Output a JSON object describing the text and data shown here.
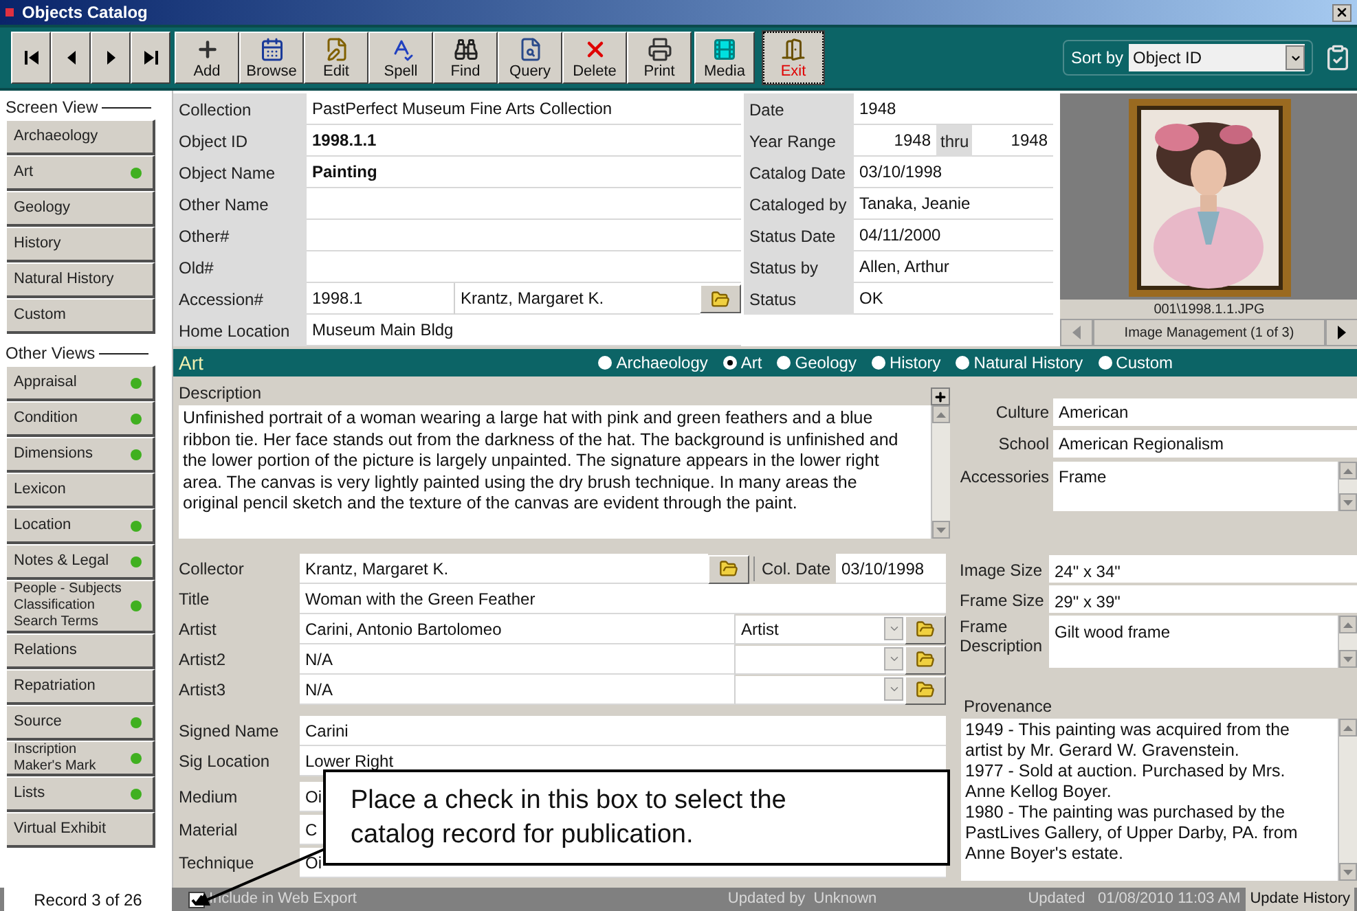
{
  "window": {
    "title": "Objects Catalog"
  },
  "toolbar": [
    {
      "kind": "add",
      "label": "Add"
    },
    {
      "kind": "browse",
      "label": "Browse"
    },
    {
      "kind": "edit",
      "label": "Edit"
    },
    {
      "kind": "spell",
      "label": "Spell"
    },
    {
      "kind": "find",
      "label": "Find"
    },
    {
      "kind": "query",
      "label": "Query"
    },
    {
      "kind": "delete",
      "label": "Delete"
    },
    {
      "kind": "print",
      "label": "Print"
    },
    {
      "kind": "media",
      "label": "Media"
    },
    {
      "kind": "exit",
      "label": "Exit"
    }
  ],
  "sort": {
    "label": "Sort by",
    "value": "Object ID"
  },
  "sidebar": {
    "screen_view": {
      "title": "Screen View",
      "items": [
        {
          "label": "Archaeology",
          "has_data": false
        },
        {
          "label": "Art",
          "has_data": true
        },
        {
          "label": "Geology",
          "has_data": false
        },
        {
          "label": "History",
          "has_data": false
        },
        {
          "label": "Natural History",
          "has_data": false
        },
        {
          "label": "Custom",
          "has_data": false
        }
      ]
    },
    "other_views": {
      "title": "Other Views",
      "items": [
        {
          "label": "Appraisal",
          "has_data": true
        },
        {
          "label": "Condition",
          "has_data": true
        },
        {
          "label": "Dimensions",
          "has_data": true
        },
        {
          "label": "Lexicon",
          "has_data": false
        },
        {
          "label": "Location",
          "has_data": true
        },
        {
          "label": "Notes & Legal",
          "has_data": true
        },
        {
          "label": "People - Subjects\nClassification\nSearch Terms",
          "has_data": true
        },
        {
          "label": "Relations",
          "has_data": false
        },
        {
          "label": "Repatriation",
          "has_data": false
        },
        {
          "label": "Source",
          "has_data": true
        },
        {
          "label": "Inscription\nMaker's Mark",
          "has_data": true
        },
        {
          "label": "Lists",
          "has_data": true
        },
        {
          "label": "Virtual Exhibit",
          "has_data": false
        }
      ]
    }
  },
  "main_fields": [
    {
      "kind": "text",
      "label": "Collection",
      "value": "PastPerfect Museum Fine Arts Collection",
      "bold": false
    },
    {
      "kind": "text",
      "label": "Object ID",
      "value": "1998.1.1",
      "bold": true
    },
    {
      "kind": "text",
      "label": "Object Name",
      "value": "Painting",
      "bold": true
    },
    {
      "kind": "text",
      "label": "Other Name"
    },
    {
      "kind": "text",
      "label": "Other#"
    },
    {
      "kind": "text",
      "label": "Old#"
    },
    {
      "kind": "lookup",
      "label": "Accession#",
      "value": "1998.1",
      "value_2": "Krantz, Margaret K.",
      "bold": false
    },
    {
      "kind": "text",
      "label": "Home Location",
      "value": "Museum Main Bldg",
      "bold": false
    }
  ],
  "status_fields": [
    {
      "kind": "text",
      "label": "Date",
      "value": "1948"
    },
    {
      "kind": "range",
      "label": "Year Range",
      "value": "1948",
      "middle": "thru",
      "value_2": "1948"
    },
    {
      "kind": "text",
      "label": "Catalog Date",
      "value": "03/10/1998"
    },
    {
      "kind": "text",
      "label": "Cataloged by",
      "value": "Tanaka, Jeanie"
    },
    {
      "kind": "text",
      "label": "Status Date",
      "value": "04/11/2000"
    },
    {
      "kind": "text",
      "label": "Status by",
      "value": "Allen, Arthur"
    },
    {
      "kind": "text",
      "label": "Status",
      "value": "OK"
    }
  ],
  "image_panel": {
    "kind": "picture",
    "caption": "001\\1998.1.1.JPG",
    "nav_label": "Image Management (1 of 3)"
  },
  "section": {
    "title": "Art",
    "views": [
      {
        "label": "Archaeology",
        "selected": false
      },
      {
        "label": "Art",
        "selected": true
      },
      {
        "label": "Geology",
        "selected": false
      },
      {
        "label": "History",
        "selected": false
      },
      {
        "label": "Natural History",
        "selected": false
      },
      {
        "label": "Custom",
        "selected": false
      }
    ]
  },
  "description": {
    "label": "Description",
    "text": "Unfinished portrait of a woman wearing a large hat with pink and green feathers and a blue ribbon tie. Her face stands out from the darkness of the hat. The background is unfinished and the lower portion of the picture is largely unpainted. The signature appears in the lower right area. The canvas is very lightly painted using the dry brush technique. In many areas the original pencil sketch and the texture of the canvas are evident through the paint."
  },
  "art_fields": [
    {
      "kind": "text",
      "label": "Culture",
      "value": "American"
    },
    {
      "kind": "text",
      "label": "School",
      "value": "American Regionalism"
    },
    {
      "kind": "memo",
      "label": "Accessories",
      "value": "Frame"
    }
  ],
  "lower_fields": [
    [
      {
        "kind": "collector",
        "label": "Collector",
        "value": "Krantz, Margaret K.",
        "extra_label": "Col. Date",
        "extra_value": "03/10/1998"
      },
      {
        "kind": "text",
        "label": "Title",
        "value": "Woman with the Green Feather"
      },
      {
        "kind": "role",
        "label": "Artist",
        "value": "Carini, Antonio Bartolomeo",
        "role": "Artist"
      },
      {
        "kind": "role",
        "label": "Artist2",
        "value": "N/A"
      },
      {
        "kind": "role",
        "label": "Artist3",
        "value": "N/A"
      }
    ],
    [
      {
        "kind": "text",
        "label": "Signed Name",
        "value": "Carini"
      },
      {
        "kind": "text",
        "label": "Sig Location",
        "value": "Lower Right"
      }
    ],
    [
      {
        "kind": "text",
        "label": "Medium",
        "value": "Oi"
      },
      {
        "kind": "text",
        "label": "Material",
        "value": "C"
      },
      {
        "kind": "text",
        "label": "Technique",
        "value": "Oi"
      }
    ]
  ],
  "size_fields": [
    {
      "kind": "text",
      "label": "Image Size",
      "value": "24\" x 34\""
    },
    {
      "kind": "text",
      "label": "Frame Size",
      "value": "29\" x 39\""
    },
    {
      "kind": "memo",
      "label": "Frame Description",
      "value": "Gilt wood frame"
    }
  ],
  "provenance": {
    "label": "Provenance",
    "entries": [
      "1949 - This painting was acquired from the artist by Mr. Gerard W. Gravenstein.",
      "1977 - Sold at auction. Purchased by Mrs. Anne Kellog Boyer.",
      "1980 - The painting was purchased  by the PastLives Gallery, of Upper Darby, PA. from Anne Boyer's estate."
    ]
  },
  "callout": {
    "text": "Place a check in this box to select the catalog record for publication."
  },
  "status_bar": {
    "record": "Record 3 of 26",
    "web_export": {
      "label": "Include in Web Export",
      "checked": true
    },
    "updated_by": "Updated by  Unknown",
    "updated": "Updated   01/08/2010 11:03 AM",
    "history_button": "Update History"
  }
}
